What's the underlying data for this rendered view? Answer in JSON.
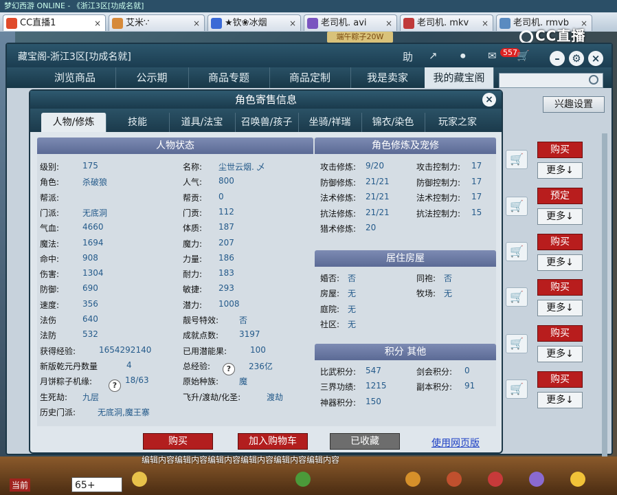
{
  "os_bar": {
    "text": "梦幻西游 ONLINE - 《浙江3区[功成名就]"
  },
  "browser_tabs": [
    {
      "label": "CC直播1",
      "color": "#e04b2b"
    },
    {
      "label": "艾米∵",
      "color": "#d68a3a"
    },
    {
      "label": "★钦❀冰烟",
      "color": "#3a6ad6"
    },
    {
      "label": "老司机. avi",
      "color": "#7a55c0"
    },
    {
      "label": "老司机. mkv",
      "color": "#c03a3a"
    },
    {
      "label": "老司机. rmvb",
      "color": "#5a8bc0"
    }
  ],
  "tab_close": "×",
  "cc_logo": "CC直播",
  "promo": "端午粽子20W",
  "main": {
    "title": "藏宝阁-浙江3区[功成名就]",
    "help": "助",
    "badge": "557",
    "nav": [
      "浏览商品",
      "公示期",
      "商品专题",
      "商品定制",
      "我是卖家",
      "我的藏宝阁"
    ],
    "interest": "兴趣设置"
  },
  "listing_buttons": [
    {
      "action": "购买",
      "more": "更多↓"
    },
    {
      "action": "预定",
      "more": "更多↓"
    },
    {
      "action": "购买",
      "more": "更多↓"
    },
    {
      "action": "购买",
      "more": "更多↓"
    },
    {
      "action": "购买",
      "more": "更多↓"
    },
    {
      "action": "购买",
      "more": "更多↓"
    }
  ],
  "dialog": {
    "title": "角色寄售信息",
    "close": "×",
    "tabs": [
      "人物/修炼",
      "技能",
      "道具/法宝",
      "召唤兽/孩子",
      "坐骑/祥瑞",
      "锦衣/染色",
      "玩家之家"
    ],
    "status": {
      "title": "人物状态",
      "left": [
        {
          "label": "级别:",
          "value": "175"
        },
        {
          "label": "角色:",
          "value": "杀破狼"
        },
        {
          "label": "帮派:",
          "value": ""
        },
        {
          "label": "门派:",
          "value": "无底洞"
        },
        {
          "label": "气血:",
          "value": "4660"
        },
        {
          "label": "魔法:",
          "value": "1694"
        },
        {
          "label": "命中:",
          "value": "908"
        },
        {
          "label": "伤害:",
          "value": "1304"
        },
        {
          "label": "防御:",
          "value": "690"
        },
        {
          "label": "速度:",
          "value": "356"
        },
        {
          "label": "法伤",
          "value": "640"
        },
        {
          "label": "法防",
          "value": "532"
        },
        {
          "label": "获得经验:",
          "value": "1654292140"
        },
        {
          "label": "新版乾元丹数量",
          "value": "4"
        },
        {
          "label": "月饼粽子机缘:",
          "value": "18/63"
        },
        {
          "label": "生死劫:",
          "value": "九层"
        },
        {
          "label": "历史门派:",
          "value": "无底洞,魔王寨"
        }
      ],
      "right": [
        {
          "label": "名称:",
          "value": "尘世云烟. 乄"
        },
        {
          "label": "人气:",
          "value": "800"
        },
        {
          "label": "帮贡:",
          "value": "0"
        },
        {
          "label": "门贡:",
          "value": "112"
        },
        {
          "label": "体质:",
          "value": "187"
        },
        {
          "label": "魔力:",
          "value": "207"
        },
        {
          "label": "力量:",
          "value": "186"
        },
        {
          "label": "耐力:",
          "value": "183"
        },
        {
          "label": "敏捷:",
          "value": "293"
        },
        {
          "label": "潜力:",
          "value": "1008"
        },
        {
          "label": "靓号特效:",
          "value": "否"
        },
        {
          "label": "成就点数:",
          "value": "3197"
        },
        {
          "label": "已用潜能果:",
          "value": "100"
        },
        {
          "label": "总经验:",
          "value": "236亿"
        },
        {
          "label": "原始种族:",
          "value": "魔"
        },
        {
          "label": "飞升/渡劫/化圣:",
          "value": "渡劫"
        }
      ],
      "qmark": "?"
    },
    "cultivation": {
      "title": "角色修炼及宠修",
      "left": [
        {
          "label": "攻击修炼:",
          "value": "9/20"
        },
        {
          "label": "防御修炼:",
          "value": "21/21"
        },
        {
          "label": "法术修炼:",
          "value": "21/21"
        },
        {
          "label": "抗法修炼:",
          "value": "21/21"
        },
        {
          "label": "猎术修炼:",
          "value": "20"
        }
      ],
      "right": [
        {
          "label": "攻击控制力:",
          "value": "17"
        },
        {
          "label": "防御控制力:",
          "value": "17"
        },
        {
          "label": "法术控制力:",
          "value": "17"
        },
        {
          "label": "抗法控制力:",
          "value": "15"
        }
      ]
    },
    "housing": {
      "title": "居住房屋",
      "left": [
        {
          "label": "婚否:",
          "value": "否"
        },
        {
          "label": "房屋:",
          "value": "无"
        },
        {
          "label": "庭院:",
          "value": "无"
        },
        {
          "label": "社区:",
          "value": "无"
        }
      ],
      "right": [
        {
          "label": "同袍:",
          "value": "否"
        },
        {
          "label": "牧场:",
          "value": "无"
        }
      ]
    },
    "points": {
      "title": "积分 其他",
      "left": [
        {
          "label": "比武积分:",
          "value": "547"
        },
        {
          "label": "三界功绩:",
          "value": "1215"
        },
        {
          "label": "神器积分:",
          "value": "150"
        }
      ],
      "right": [
        {
          "label": "剑会积分:",
          "value": "0"
        },
        {
          "label": "副本积分:",
          "value": "91"
        }
      ]
    },
    "buttons": {
      "buy": "购买",
      "add_cart": "加入购物车",
      "favorited": "已收藏",
      "web": "使用网页版"
    }
  },
  "game_bar": {
    "current": "当前",
    "chat_value": "65+"
  },
  "danmaku": "编辑内容编辑内容编辑内容编辑内容编辑内容编辑内容",
  "colors": {
    "buy_red": "#b81d1d",
    "link_blue": "#1c3fc4",
    "section_header": "#6b78a4"
  }
}
